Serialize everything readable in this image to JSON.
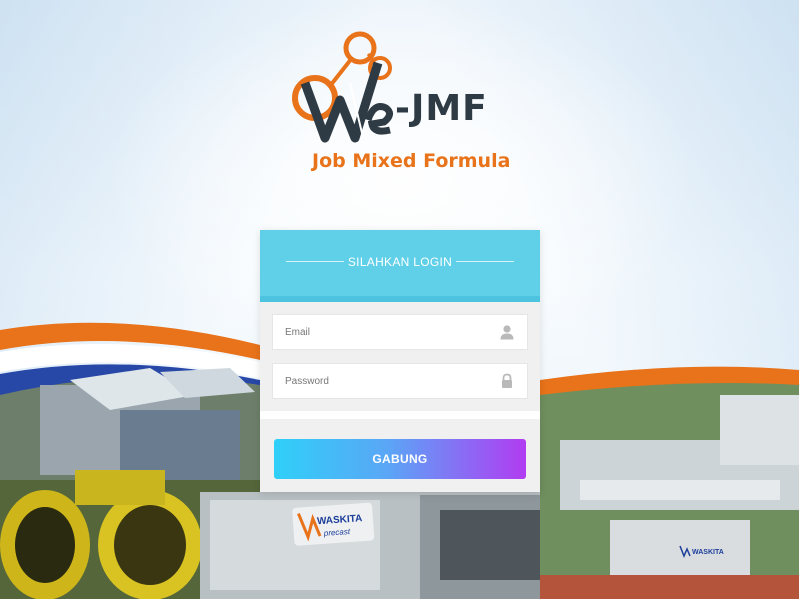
{
  "brand": {
    "logo_text": "-JMF",
    "tagline": "Job Mixed Formula",
    "primary_color": "#e8731a",
    "dark_color": "#2e3a44"
  },
  "login": {
    "title": "SILAHKAN LOGIN",
    "header_color": "#5fd0e8",
    "email": {
      "placeholder": "Email",
      "value": "",
      "icon": "user-icon"
    },
    "password": {
      "placeholder": "Password",
      "value": "",
      "icon": "lock-icon"
    },
    "submit_label": "GABUNG"
  },
  "background": {
    "banner_text_left": "WASKITA",
    "banner_subtext_left": "precast",
    "banner_text_right": "WASKITA"
  }
}
